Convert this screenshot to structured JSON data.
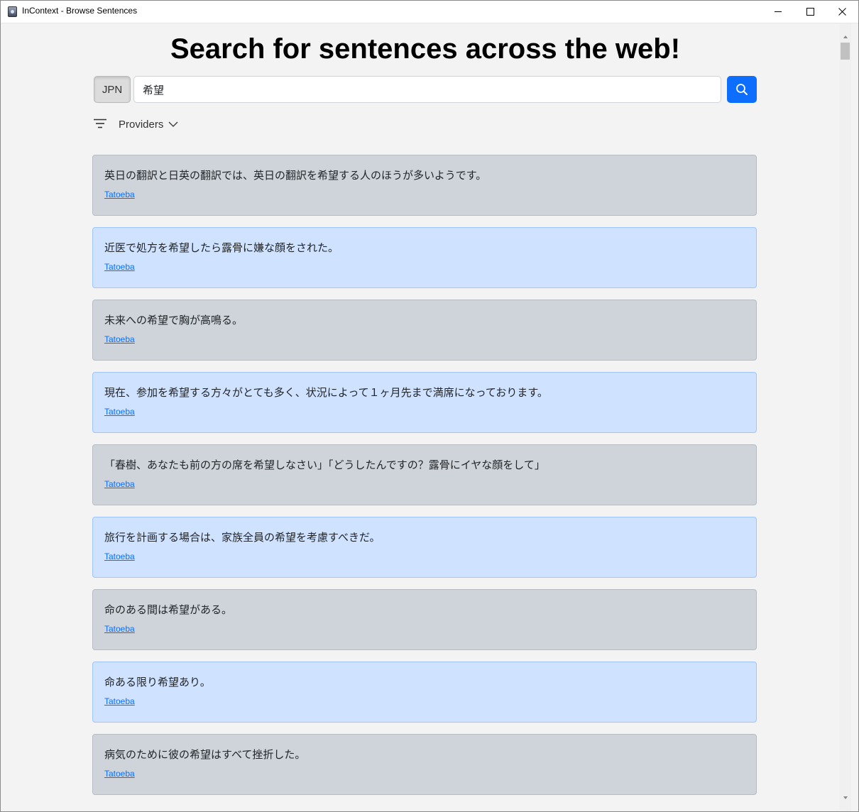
{
  "window": {
    "title": "InContext - Browse Sentences"
  },
  "page": {
    "headline": "Search for sentences across the web!"
  },
  "search": {
    "language": "JPN",
    "query": "希望"
  },
  "filters": {
    "providers_label": "Providers"
  },
  "colors": {
    "primary": "#0d6efd",
    "card_grey": "#ced4da",
    "card_blue": "#cfe2ff"
  },
  "results": [
    {
      "sentence": "英日の翻訳と日英の翻訳では、英日の翻訳を希望する人のほうが多いようです。",
      "source": "Tatoeba",
      "style": "grey"
    },
    {
      "sentence": "近医で処方を希望したら露骨に嫌な顔をされた。",
      "source": "Tatoeba",
      "style": "blue"
    },
    {
      "sentence": "未来への希望で胸が高鳴る。",
      "source": "Tatoeba",
      "style": "grey"
    },
    {
      "sentence": "現在、参加を希望する方々がとても多く、状況によって１ヶ月先まで満席になっております。",
      "source": "Tatoeba",
      "style": "blue"
    },
    {
      "sentence": "「春樹、あなたも前の方の席を希望しなさい」「どうしたんですの？露骨にイヤな顔をして」",
      "source": "Tatoeba",
      "style": "grey"
    },
    {
      "sentence": "旅行を計画する場合は、家族全員の希望を考慮すべきだ。",
      "source": "Tatoeba",
      "style": "blue"
    },
    {
      "sentence": "命のある間は希望がある。",
      "source": "Tatoeba",
      "style": "grey"
    },
    {
      "sentence": "命ある限り希望あり。",
      "source": "Tatoeba",
      "style": "blue"
    },
    {
      "sentence": "病気のために彼の希望はすべて挫折した。",
      "source": "Tatoeba",
      "style": "grey"
    }
  ]
}
